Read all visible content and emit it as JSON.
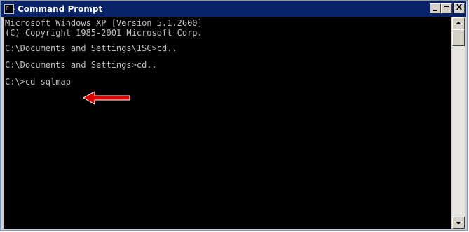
{
  "window": {
    "title": "Command Prompt",
    "icon": "cmd-icon",
    "icon_text": "C:\\"
  },
  "title_buttons": {
    "minimize": "minimize-icon",
    "maximize": "maximize-icon",
    "close": "close-icon",
    "close_glyph": "X"
  },
  "console": {
    "lines": [
      "Microsoft Windows XP [Version 5.1.2600]",
      "(C) Copyright 1985-2001 Microsoft Corp.",
      "",
      "C:\\Documents and Settings\\ISC>cd..",
      "",
      "C:\\Documents and Settings>cd..",
      "",
      "C:\\>cd sqlmap"
    ],
    "background": "#000000",
    "text_color": "#c0c0c0"
  },
  "annotation": {
    "icon": "red-arrow-icon",
    "color": "#e00000"
  }
}
